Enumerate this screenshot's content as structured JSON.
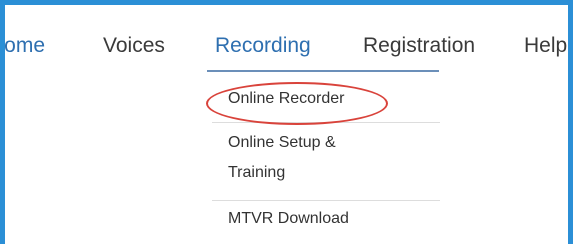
{
  "nav": {
    "home": "Home",
    "voices": "Voices",
    "recording": "Recording",
    "registration": "Registration",
    "help": "Help"
  },
  "dropdown": {
    "items": [
      {
        "label": "Online Recorder"
      },
      {
        "label": "Online Setup &",
        "label2": "Training"
      },
      {
        "label": "MTVR Download"
      }
    ]
  },
  "colors": {
    "frame": "#2b8fd6",
    "active_nav": "#2e6fb0",
    "highlight": "#d9433b"
  }
}
